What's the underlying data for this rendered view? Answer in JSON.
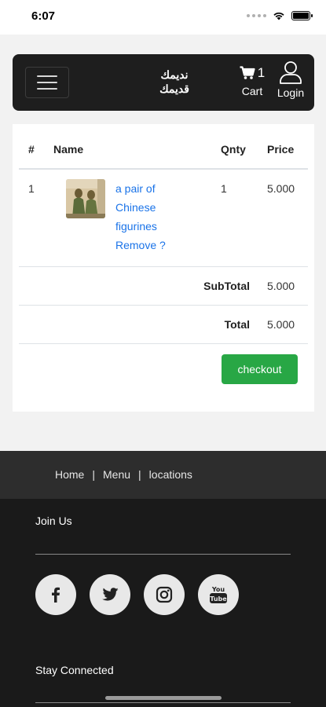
{
  "status_bar": {
    "time": "6:07"
  },
  "navbar": {
    "logo_line1": "نديمك",
    "logo_line2": "قديمك",
    "cart_count": "1",
    "cart_label": "Cart",
    "login_label": "Login"
  },
  "cart_table": {
    "headers": {
      "num": "#",
      "name": "Name",
      "qnty": "Qnty",
      "price": "Price"
    },
    "items": [
      {
        "num": "1",
        "name_line1": "a pair of",
        "name_line2": "Chinese",
        "name_line3": "figurines",
        "remove_label": "Remove ?",
        "qnty": "1",
        "price": "5.000"
      }
    ],
    "subtotal_label": "SubTotal",
    "subtotal_value": "5.000",
    "total_label": "Total",
    "total_value": "5.000",
    "checkout_label": "checkout"
  },
  "footer": {
    "links": [
      "Home",
      "Menu",
      "locations"
    ],
    "separator": "|",
    "join_title": "Join Us",
    "socials": [
      "facebook-icon",
      "twitter-icon",
      "instagram-icon",
      "youtube-icon"
    ],
    "youtube_text_top": "You",
    "youtube_text_bottom": "Tube",
    "stay_title": "Stay Connected"
  },
  "colors": {
    "navbar_bg": "#1e1e1e",
    "checkout_green": "#28a745",
    "link_blue": "#1a73e8",
    "footer_bg": "#1a1a1a"
  }
}
